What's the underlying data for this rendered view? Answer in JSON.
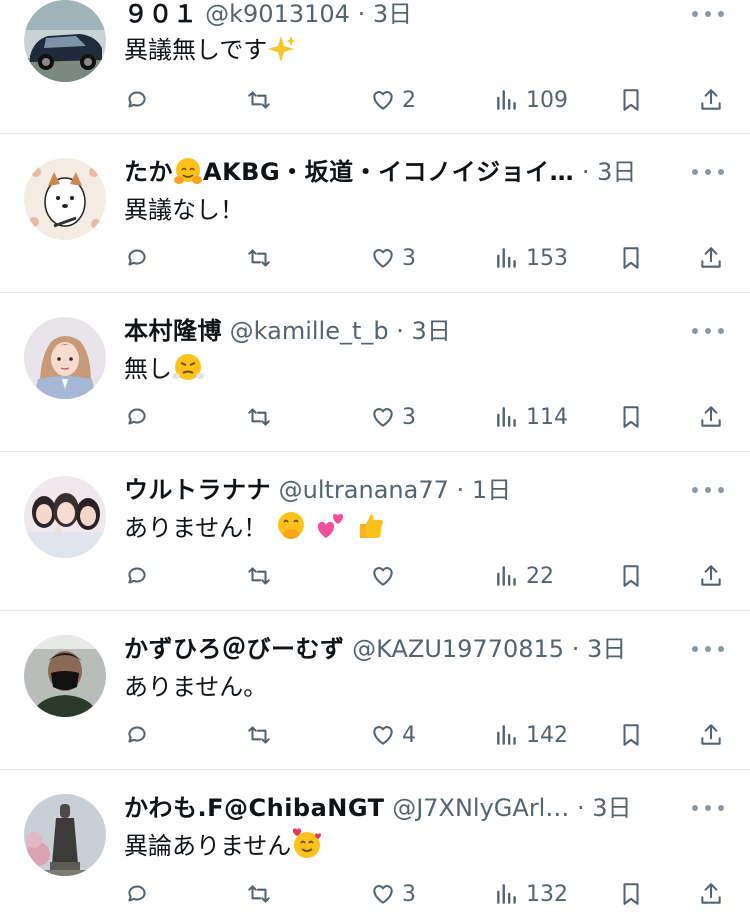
{
  "replies": [
    {
      "name": "９０１",
      "handle": "@k9013104",
      "dot": "·",
      "time": "3日",
      "text": "異議無しです",
      "emojis": [
        "sparkles"
      ],
      "likes": "2",
      "views": "109",
      "avatar": "car-photo"
    },
    {
      "name": "たか",
      "name_suffix": "AKBG・坂道・イコノイジョイ…",
      "handle": "",
      "dot": "·",
      "time": "3日",
      "text": "異議なし！",
      "emojis": [],
      "likes": "3",
      "views": "153",
      "avatar": "cartoon-dog"
    },
    {
      "name": "本村隆博",
      "handle": "@kamille_t_b",
      "dot": "·",
      "time": "3日",
      "text": "無し",
      "emojis": [
        "steam-face"
      ],
      "likes": "3",
      "views": "114",
      "avatar": "girl-photo"
    },
    {
      "name": "ウルトラナナ",
      "handle": "@ultranana77",
      "dot": "·",
      "time": "1日",
      "text": "ありません！",
      "emojis": [
        "hand-over-mouth",
        "two-hearts",
        "thumbs-up"
      ],
      "likes": "",
      "views": "22",
      "avatar": "group-photo"
    },
    {
      "name": "かずひろ＠びーむず",
      "handle": "@KAZU19770815",
      "dot": "·",
      "time": "3日",
      "text": "ありません。",
      "emojis": [],
      "likes": "4",
      "views": "142",
      "avatar": "man-mask-photo"
    },
    {
      "name": "かわも.F@ChibaNGT",
      "handle": "@J7XNlyGArl…",
      "dot": "·",
      "time": "3日",
      "text": "異論ありません",
      "emojis": [
        "smiling-face-with-hearts"
      ],
      "likes": "3",
      "views": "132",
      "avatar": "statue-photo"
    }
  ],
  "icons": {
    "reply": "reply-icon",
    "retweet": "retweet-icon",
    "like": "heart-icon",
    "views": "views-icon",
    "bookmark": "bookmark-icon",
    "share": "share-icon",
    "more": "more-icon"
  },
  "colors": {
    "text": "#0f1419",
    "secondary": "#536471",
    "separator": "#e6e9ec"
  }
}
